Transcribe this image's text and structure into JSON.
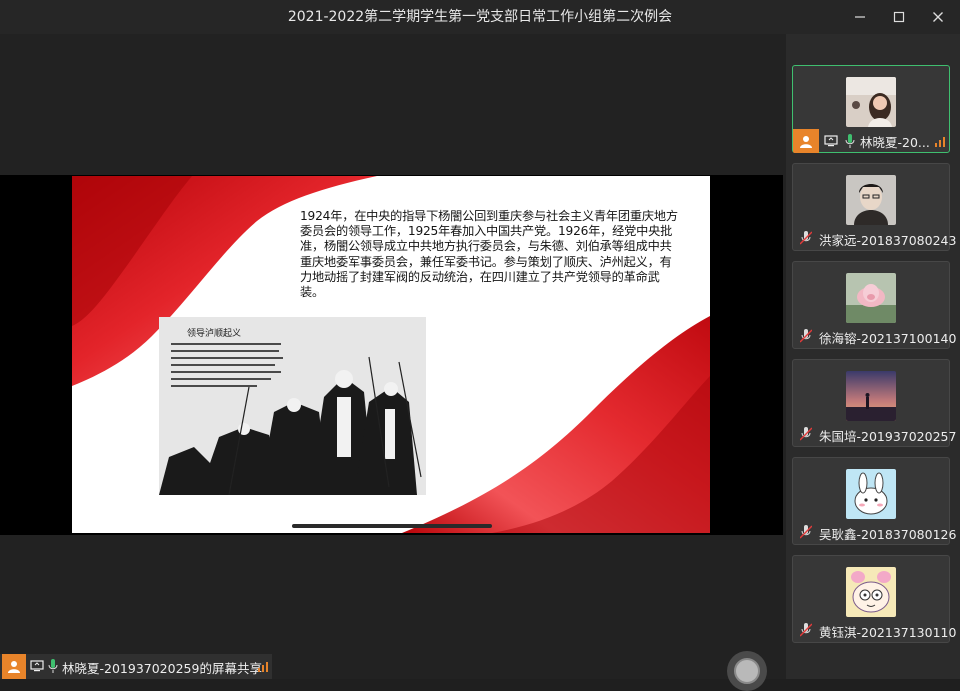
{
  "window": {
    "title": "2021-2022第二学期学生第一党支部日常工作小组第二次例会",
    "minimize_icon": "minimize-icon",
    "maximize_icon": "maximize-icon",
    "close_icon": "close-icon"
  },
  "shared_slide": {
    "paragraph": "1924年，在中央的指导下杨闇公回到重庆参与社会主义青年团重庆地方委员会的领导工作，1925年春加入中国共产党。1926年，经党中央批准，杨闇公领导成立中共地方执行委员会，与朱德、刘伯承等组成中共重庆地委军事委员会，兼任军委书记。参与策划了顺庆、泸州起义，有力地动摇了封建军阀的反动统治，在四川建立了共产党领导的革命武装。",
    "illustration_caption": "领导泸顺起义",
    "accent_color": "#d4141a"
  },
  "participants": [
    {
      "name": "林晓夏-20...",
      "is_host": true,
      "active": true,
      "avatar": "woman-avatar",
      "signal": "signal-bars-icon"
    },
    {
      "name": "洪家远-201837080243",
      "avatar": "anime-man-avatar"
    },
    {
      "name": "徐海镕-202137100140",
      "avatar": "lotus-avatar"
    },
    {
      "name": "朱国培-201937020257",
      "avatar": "sunset-avatar"
    },
    {
      "name": "吴耿鑫-201837080126",
      "avatar": "rabbit-avatar"
    },
    {
      "name": "黄钰淇-202137130110",
      "avatar": "cartoon-avatar"
    }
  ],
  "bottom_bar": {
    "label": "林晓夏-201937020259的屏幕共享"
  }
}
